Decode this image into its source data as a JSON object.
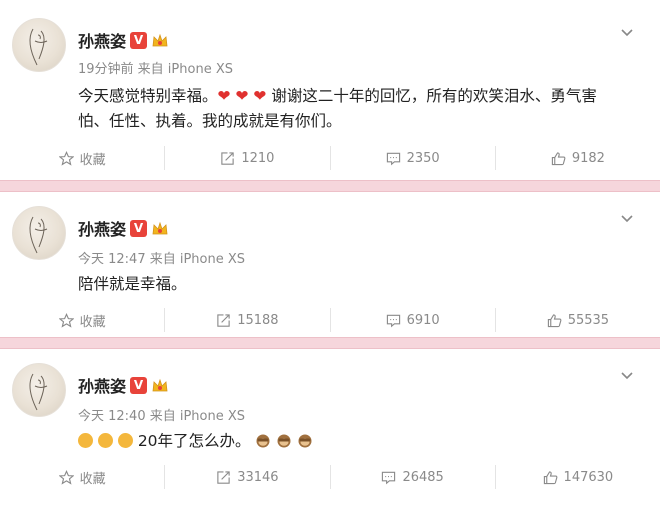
{
  "posts": [
    {
      "user": "孙燕姿",
      "meta": "19分钟前 来自 iPhone XS",
      "content": "今天感觉特别幸福。❤ ❤ ❤  谢谢这二十年的回忆，所有的欢笑泪水、勇气害怕、任性、执着。我的成就是有你们。",
      "text_a": "今天感觉特别幸福。",
      "text_b": "谢谢这二十年的回忆，所有的欢笑泪水、勇气害",
      "text_c": "怕、任性、执着。我的成就是有你们。",
      "favorite": "收藏",
      "reposts": "1210",
      "comments": "2350",
      "likes": "9182"
    },
    {
      "user": "孙燕姿",
      "meta": "今天 12:47 来自 iPhone XS",
      "content": "陪伴就是幸福。",
      "favorite": "收藏",
      "reposts": "15188",
      "comments": "6910",
      "likes": "55535"
    },
    {
      "user": "孙燕姿",
      "meta": "今天 12:40 来自 iPhone XS",
      "content": "20年了怎么办。",
      "favorite": "收藏",
      "reposts": "33146",
      "comments": "26485",
      "likes": "147630"
    }
  ],
  "verified_label": "V",
  "colors": {
    "verified": "#e8433a",
    "separator": "#f6d6dc",
    "meta": "#8a8a8a",
    "heart": "#e0312f"
  }
}
